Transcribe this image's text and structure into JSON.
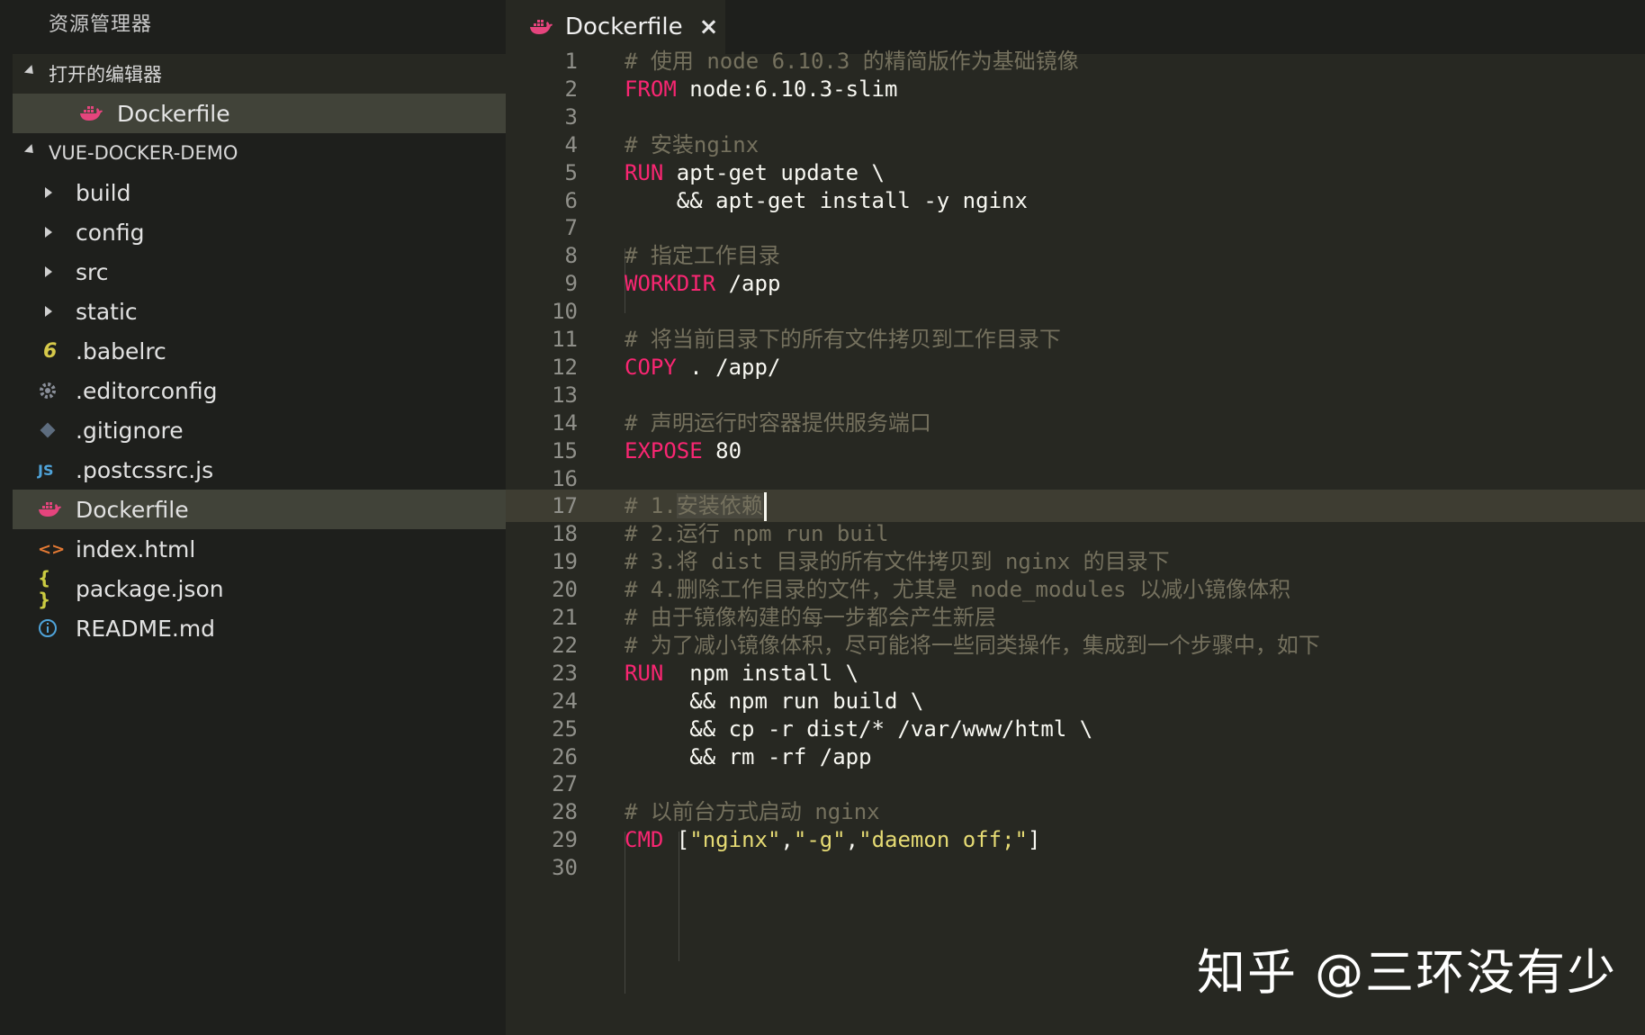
{
  "sidebar": {
    "title": "资源管理器",
    "open_editors": {
      "label": "打开的编辑器",
      "items": [
        {
          "label": "Dockerfile",
          "icon": "docker-icon"
        }
      ]
    },
    "project": {
      "label": "VUE-DOCKER-DEMO",
      "items": [
        {
          "label": "build",
          "icon": "folder-arrow"
        },
        {
          "label": "config",
          "icon": "folder-arrow"
        },
        {
          "label": "src",
          "icon": "folder-arrow"
        },
        {
          "label": "static",
          "icon": "folder-arrow"
        },
        {
          "label": ".babelrc",
          "icon": "babel-icon"
        },
        {
          "label": ".editorconfig",
          "icon": "gear-icon"
        },
        {
          "label": ".gitignore",
          "icon": "git-icon"
        },
        {
          "label": ".postcssrc.js",
          "icon": "js-icon"
        },
        {
          "label": "Dockerfile",
          "icon": "docker-icon",
          "selected": true
        },
        {
          "label": "index.html",
          "icon": "html-icon"
        },
        {
          "label": "package.json",
          "icon": "json-icon"
        },
        {
          "label": "README.md",
          "icon": "info-icon"
        }
      ]
    }
  },
  "tab": {
    "label": "Dockerfile",
    "close": "×"
  },
  "editor": {
    "lines": [
      {
        "n": "1",
        "tokens": [
          {
            "t": "cmt",
            "v": "# 使用 node 6.10.3 的精简版作为基础镜像"
          }
        ]
      },
      {
        "n": "2",
        "tokens": [
          {
            "t": "kw",
            "v": "FROM"
          },
          {
            "t": "txt",
            "v": " node:6.10.3-slim"
          }
        ]
      },
      {
        "n": "3",
        "tokens": []
      },
      {
        "n": "4",
        "tokens": [
          {
            "t": "cmt",
            "v": "# 安装nginx"
          }
        ]
      },
      {
        "n": "5",
        "tokens": [
          {
            "t": "kw",
            "v": "RUN"
          },
          {
            "t": "txt",
            "v": " apt-get update \\"
          }
        ]
      },
      {
        "n": "6",
        "tokens": [
          {
            "t": "txt",
            "v": "    && apt-get install -y nginx"
          }
        ]
      },
      {
        "n": "7",
        "tokens": []
      },
      {
        "n": "8",
        "tokens": [
          {
            "t": "cmt",
            "v": "# 指定工作目录"
          }
        ]
      },
      {
        "n": "9",
        "tokens": [
          {
            "t": "kw",
            "v": "WORKDIR"
          },
          {
            "t": "txt",
            "v": " /app"
          }
        ]
      },
      {
        "n": "10",
        "tokens": []
      },
      {
        "n": "11",
        "tokens": [
          {
            "t": "cmt",
            "v": "# 将当前目录下的所有文件拷贝到工作目录下"
          }
        ]
      },
      {
        "n": "12",
        "tokens": [
          {
            "t": "kw",
            "v": "COPY"
          },
          {
            "t": "txt",
            "v": " . /app/"
          }
        ]
      },
      {
        "n": "13",
        "tokens": []
      },
      {
        "n": "14",
        "tokens": [
          {
            "t": "cmt",
            "v": "# 声明运行时容器提供服务端口"
          }
        ]
      },
      {
        "n": "15",
        "tokens": [
          {
            "t": "kw",
            "v": "EXPOSE"
          },
          {
            "t": "txt",
            "v": " 80"
          }
        ]
      },
      {
        "n": "16",
        "tokens": []
      },
      {
        "n": "17",
        "current": true,
        "tokens": [
          {
            "t": "cmt",
            "v": "# 1."
          },
          {
            "t": "cmt sel",
            "v": "安装依赖"
          },
          {
            "t": "cursor",
            "v": ""
          }
        ]
      },
      {
        "n": "18",
        "tokens": [
          {
            "t": "cmt",
            "v": "# 2.运行 npm run buil"
          }
        ]
      },
      {
        "n": "19",
        "tokens": [
          {
            "t": "cmt",
            "v": "# 3.将 dist 目录的所有文件拷贝到 nginx 的目录下"
          }
        ]
      },
      {
        "n": "20",
        "tokens": [
          {
            "t": "cmt",
            "v": "# 4.删除工作目录的文件，尤其是 node_modules 以减小镜像体积"
          }
        ]
      },
      {
        "n": "21",
        "tokens": [
          {
            "t": "cmt",
            "v": "# 由于镜像构建的每一步都会产生新层"
          }
        ]
      },
      {
        "n": "22",
        "tokens": [
          {
            "t": "cmt",
            "v": "# 为了减小镜像体积，尽可能将一些同类操作，集成到一个步骤中，如下"
          }
        ]
      },
      {
        "n": "23",
        "tokens": [
          {
            "t": "kw",
            "v": "RUN"
          },
          {
            "t": "txt",
            "v": "  npm install \\"
          }
        ]
      },
      {
        "n": "24",
        "tokens": [
          {
            "t": "txt",
            "v": "     && npm run build \\"
          }
        ]
      },
      {
        "n": "25",
        "tokens": [
          {
            "t": "txt",
            "v": "     && cp -r dist/* /var/www/html \\"
          }
        ]
      },
      {
        "n": "26",
        "tokens": [
          {
            "t": "txt",
            "v": "     && rm -rf /app"
          }
        ]
      },
      {
        "n": "27",
        "tokens": []
      },
      {
        "n": "28",
        "tokens": [
          {
            "t": "cmt",
            "v": "# 以前台方式启动 nginx"
          }
        ]
      },
      {
        "n": "29",
        "tokens": [
          {
            "t": "kw",
            "v": "CMD"
          },
          {
            "t": "txt",
            "v": " ["
          },
          {
            "t": "str",
            "v": "\"nginx\""
          },
          {
            "t": "txt",
            "v": ","
          },
          {
            "t": "str",
            "v": "\"-g\""
          },
          {
            "t": "txt",
            "v": ","
          },
          {
            "t": "str",
            "v": "\"daemon off;\""
          },
          {
            "t": "txt",
            "v": "]"
          }
        ]
      },
      {
        "n": "30",
        "tokens": []
      }
    ]
  },
  "watermark": "知乎 @三环没有少",
  "colors": {
    "background": "#272822",
    "sidebar": "#1e1f1c",
    "keyword": "#f92672",
    "comment": "#75715e",
    "string": "#e6db74",
    "text": "#f8f8f2",
    "docker_icon": "#e5447d"
  }
}
